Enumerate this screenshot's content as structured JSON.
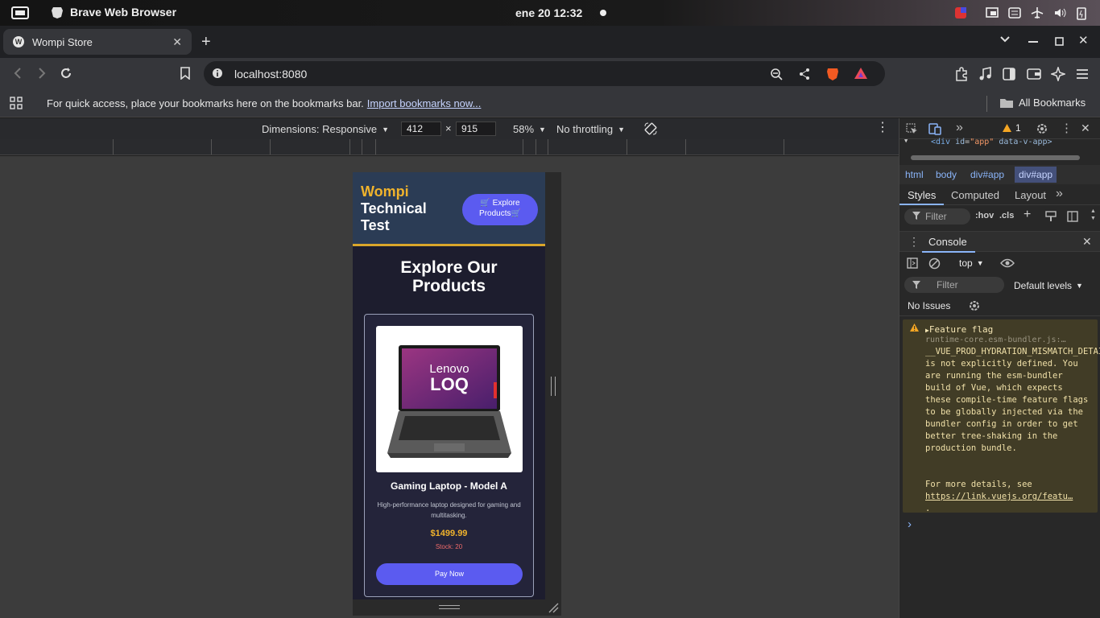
{
  "system": {
    "app_name": "Brave Web Browser",
    "datetime": "ene 20  12:32"
  },
  "browser": {
    "tab_title": "Wompi Store",
    "favicon_letter": "W",
    "url": "localhost:8080",
    "bookmarks_message": "For quick access, place your bookmarks here on the bookmarks bar.",
    "bookmarks_link": "Import bookmarks now...",
    "all_bookmarks": "All Bookmarks"
  },
  "device_toolbar": {
    "dimensions_label": "Dimensions: Responsive",
    "width": "412",
    "height": "915",
    "times": "×",
    "zoom": "58%",
    "throttling": "No throttling"
  },
  "app": {
    "brand_top": "Wompi",
    "brand_bottom": "Technical Test",
    "explore_button": "🛒 Explore Products🛒",
    "heading": "Explore Our Products",
    "product": {
      "image_text_1": "Lenovo",
      "image_text_2": "LOQ",
      "name": "Gaming Laptop - Model A",
      "description": "High-performance laptop designed for gaming and multitasking.",
      "price": "$1499.99",
      "stock": "Stock: 20",
      "pay_button": "Pay Now"
    }
  },
  "devtools": {
    "issues_badge": "1",
    "dom_snippet_tag": "<div",
    "dom_snippet_attr": "id",
    "dom_snippet_val": "\"app\"",
    "dom_snippet_rest": "data-v-app>",
    "breadcrumbs": [
      "html",
      "body",
      "div#app",
      "div#app"
    ],
    "panel_tabs": [
      "Styles",
      "Computed",
      "Layout"
    ],
    "styles_filter_placeholder": "Filter",
    "hov": ":hov",
    "cls": ".cls",
    "console_tab": "Console",
    "context": "top",
    "console_filter_placeholder": "Filter",
    "levels": "Default levels",
    "no_issues": "No Issues",
    "warning": {
      "title": "Feature flag",
      "source": "runtime-core.esm-bundler.js:…",
      "body": "__VUE_PROD_HYDRATION_MISMATCH_DETAILS__ is not explicitly defined. You are running the esm-bundler build of Vue, which expects these compile-time feature flags to be globally injected via the bundler config in order to get better tree-shaking in the production bundle.",
      "more_label": "For more details, see",
      "more_link": "https://link.vuejs.org/featu…",
      "period": "."
    },
    "prompt": "›"
  },
  "colors": {
    "accent": "#5b5bf0",
    "brand_yellow": "#f0b32c",
    "warning_bg": "#413c26"
  }
}
